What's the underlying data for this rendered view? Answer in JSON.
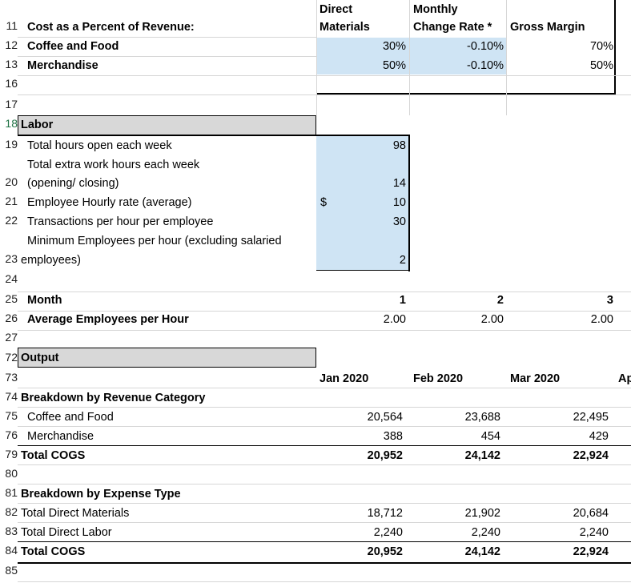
{
  "rows": {
    "r11": "11",
    "r12": "12",
    "r13": "13",
    "r16": "16",
    "r17": "17",
    "r18": "18",
    "r19": "19",
    "r20": "20",
    "r21": "21",
    "r22": "22",
    "r23": "23",
    "r24": "24",
    "r25": "25",
    "r26": "26",
    "r27": "27",
    "r72": "72",
    "r73": "73",
    "r74": "74",
    "r75": "75",
    "r76": "76",
    "r79": "79",
    "r80": "80",
    "r81": "81",
    "r82": "82",
    "r83": "83",
    "r84": "84",
    "r85": "85"
  },
  "cost_section": {
    "header_direct_line1": "Direct",
    "header_direct_line2": "Materials",
    "header_monthly_line1": "Monthly",
    "header_monthly_line2": "Change Rate *",
    "header_gross_margin": "Gross Margin",
    "title": "Cost as a Percent of Revenue:",
    "items": [
      {
        "label": "Coffee and Food",
        "direct": "30%",
        "change": "-0.10%",
        "margin": "70%"
      },
      {
        "label": "Merchandise",
        "direct": "50%",
        "change": "-0.10%",
        "margin": "50%"
      }
    ]
  },
  "labor": {
    "title": "Labor",
    "total_hours_label": "Total hours open each week",
    "total_hours_value": "98",
    "extra_hours_label_line1": "Total extra work hours each week",
    "extra_hours_label_line2": "(opening/ closing)",
    "extra_hours_value": "14",
    "hourly_rate_label": "Employee Hourly rate (average)",
    "hourly_rate_currency": "$",
    "hourly_rate_value": "10",
    "transactions_label": "Transactions per hour per employee",
    "transactions_value": "30",
    "min_employees_label_line1": "Minimum Employees per hour (excluding salaried",
    "min_employees_label_line2": "employees)",
    "min_employees_value": "2"
  },
  "months": {
    "month_label": "Month",
    "month_values": [
      "1",
      "2",
      "3"
    ],
    "avg_employees_label": "Average Employees per Hour",
    "avg_employees_values": [
      "2.00",
      "2.00",
      "2.00"
    ]
  },
  "output": {
    "title": "Output",
    "columns": [
      "Jan 2020",
      "Feb 2020",
      "Mar 2020",
      "Ap"
    ],
    "revenue_title": "Breakdown by Revenue Category",
    "revenue_rows": [
      {
        "label": "Coffee and Food",
        "values": [
          "20,564",
          "23,688",
          "22,495"
        ]
      },
      {
        "label": "Merchandise",
        "values": [
          "388",
          "454",
          "429"
        ]
      }
    ],
    "revenue_total": {
      "label": "Total COGS",
      "values": [
        "20,952",
        "24,142",
        "22,924"
      ]
    },
    "expense_title": "Breakdown by Expense Type",
    "expense_rows": [
      {
        "label": "Total Direct Materials",
        "values": [
          "18,712",
          "21,902",
          "20,684"
        ]
      },
      {
        "label": "Total Direct Labor",
        "values": [
          "2,240",
          "2,240",
          "2,240"
        ]
      }
    ],
    "expense_total": {
      "label": "Total COGS",
      "values": [
        "20,952",
        "24,142",
        "22,924"
      ]
    }
  },
  "colors": {
    "input_fill": "#cfe4f4",
    "section_fill": "#d8d8d8",
    "selected_row_header": "#217346"
  }
}
